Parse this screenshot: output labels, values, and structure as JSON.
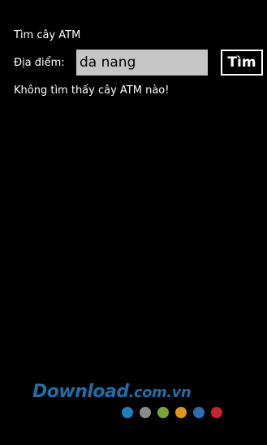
{
  "header": {
    "title": "Tìm cây ATM"
  },
  "search": {
    "location_label": "Địa điểm:",
    "value": "da nang",
    "button_label": "Tìm"
  },
  "status": {
    "message": "Không tìm thấy cây ATM nào!"
  },
  "watermark": {
    "main": "Download",
    "domain": ".com.vn",
    "dot_colors": [
      "#1b7fc0",
      "#8a8a8a",
      "#7aa534",
      "#e0951a",
      "#2a6fb5",
      "#c9242a"
    ]
  },
  "colors": {
    "background": "#000000",
    "text": "#ffffff",
    "input_background": "#c6c6c6",
    "watermark_blue": "#1e6fa9"
  }
}
